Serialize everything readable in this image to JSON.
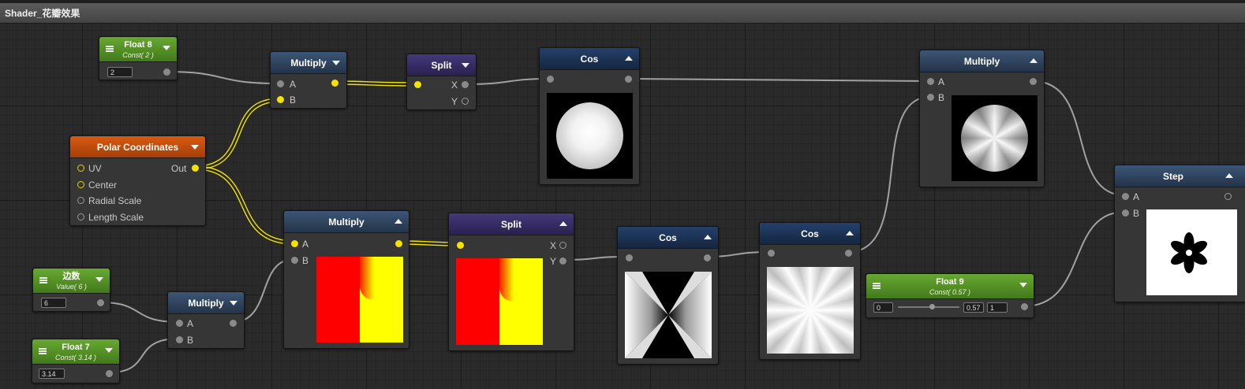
{
  "window": {
    "title": "Shader_花瓣效果"
  },
  "nodes": {
    "float8": {
      "title": "Float 8",
      "subtitle": "Const( 2 )",
      "value": "2"
    },
    "polar": {
      "title": "Polar Coordinates",
      "inputs": [
        "UV",
        "Center",
        "Radial Scale",
        "Length Scale"
      ],
      "output": "Out"
    },
    "edge": {
      "title": "边数",
      "subtitle": "Value( 6 )",
      "value": "6"
    },
    "float7": {
      "title": "Float 7",
      "subtitle": "Const( 3.14 )",
      "value": "3.14"
    },
    "mul_top": {
      "title": "Multiply",
      "in_a": "A",
      "in_b": "B"
    },
    "split_top": {
      "title": "Split",
      "out_x": "X",
      "out_y": "Y"
    },
    "cos_top": {
      "title": "Cos"
    },
    "mul_right": {
      "title": "Multiply",
      "in_a": "A",
      "in_b": "B"
    },
    "step": {
      "title": "Step",
      "in_a": "A",
      "in_b": "B"
    },
    "mul_small": {
      "title": "Multiply",
      "in_a": "A",
      "in_b": "B"
    },
    "mul_mid": {
      "title": "Multiply",
      "in_a": "A",
      "in_b": "B"
    },
    "split_mid": {
      "title": "Split",
      "out_x": "X",
      "out_y": "Y"
    },
    "cos_mid": {
      "title": "Cos"
    },
    "cos_right": {
      "title": "Cos"
    },
    "float9": {
      "title": "Float 9",
      "subtitle": "Const( 0.57 )",
      "min": "0",
      "value": "0.57",
      "max": "1"
    }
  },
  "colors": {
    "wire_yellow": "#f2e200",
    "wire_gray": "#9a9a9a",
    "preview_red": "#ff0000",
    "preview_yellow": "#ffff00"
  },
  "icons": [
    "menu-icon",
    "dropdown-arrow-icon",
    "collapse-arrow-icon"
  ]
}
